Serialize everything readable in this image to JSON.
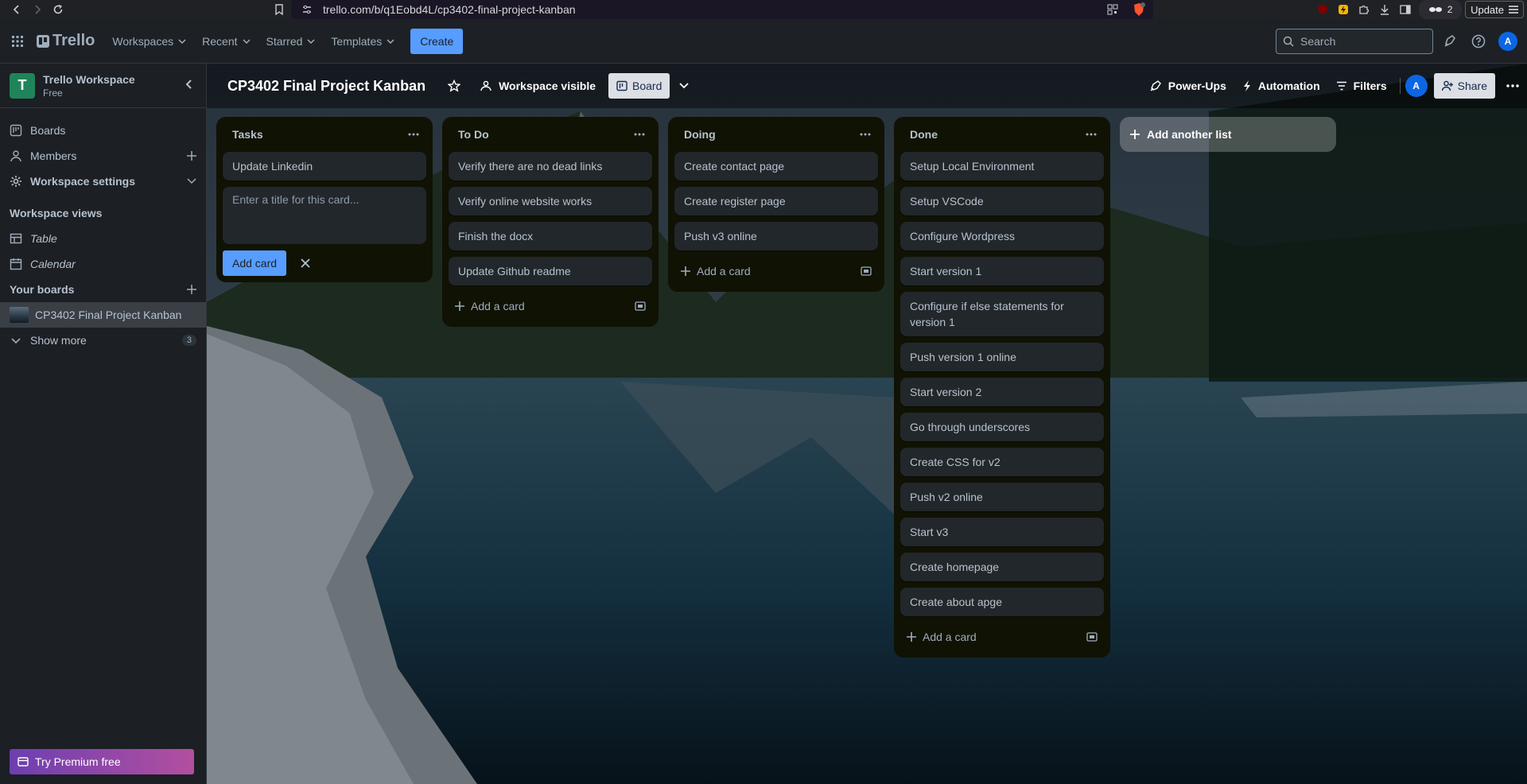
{
  "browser": {
    "url": "trello.com/b/q1Eobd4L/cp3402-final-project-kanban",
    "update_label": "Update",
    "ext_count": "2"
  },
  "header": {
    "logo": "Trello",
    "nav": [
      {
        "label": "Workspaces"
      },
      {
        "label": "Recent"
      },
      {
        "label": "Starred"
      },
      {
        "label": "Templates"
      }
    ],
    "create_label": "Create",
    "search_placeholder": "Search",
    "avatar_initial": "A"
  },
  "sidebar": {
    "workspace_initial": "T",
    "workspace_name": "Trello Workspace",
    "workspace_plan": "Free",
    "items": [
      {
        "label": "Boards"
      },
      {
        "label": "Members"
      },
      {
        "label": "Workspace settings"
      }
    ],
    "views_title": "Workspace views",
    "views": [
      {
        "label": "Table"
      },
      {
        "label": "Calendar"
      }
    ],
    "your_boards_title": "Your boards",
    "boards": [
      {
        "label": "CP3402 Final Project Kanban"
      }
    ],
    "show_more_label": "Show more",
    "show_more_count": "3",
    "premium_label": "Try Premium free"
  },
  "board": {
    "title": "CP3402 Final Project Kanban",
    "visibility_label": "Workspace visible",
    "view_label": "Board",
    "powerups_label": "Power-Ups",
    "automation_label": "Automation",
    "filters_label": "Filters",
    "member_initial": "A",
    "share_label": "Share",
    "add_list_label": "Add another list",
    "add_card_label": "Add a card",
    "composer_placeholder": "Enter a title for this card...",
    "composer_button": "Add card",
    "lists": [
      {
        "title": "Tasks",
        "cards": [
          "Update Linkedin"
        ]
      },
      {
        "title": "To Do",
        "cards": [
          "Verify there are no dead links",
          "Verify online website works",
          "Finish the docx",
          "Update Github readme"
        ]
      },
      {
        "title": "Doing",
        "cards": [
          "Create contact page",
          "Create register page",
          "Push v3 online"
        ]
      },
      {
        "title": "Done",
        "cards": [
          "Setup Local Environment",
          "Setup VSCode",
          "Configure Wordpress",
          "Start version 1",
          "Configure if else statements for version 1",
          "Push version 1 online",
          "Start version 2",
          "Go through underscores",
          "Create CSS for v2",
          "Push v2 online",
          "Start v3",
          "Create homepage",
          "Create about apge"
        ]
      }
    ]
  },
  "colors": {
    "accent": "#579dff",
    "workspace_logo": "#1f845a",
    "list_bg": "#101204",
    "card_bg": "#22272b"
  }
}
